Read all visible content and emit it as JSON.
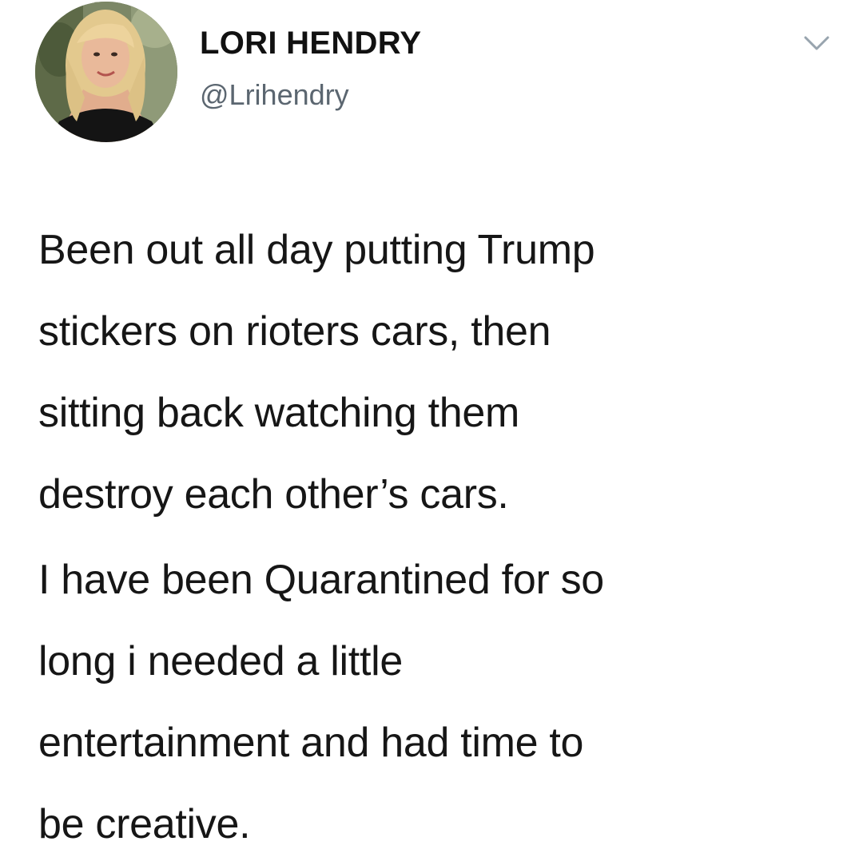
{
  "tweet": {
    "author": {
      "display_name": "LORI HENDRY",
      "handle": "@Lrihendry",
      "avatar": "profile-photo"
    },
    "menu_icon": "chevron-down-icon",
    "paragraphs": [
      "Been out all day putting Trump\nstickers on rioters cars, then\nsitting back watching them\ndestroy each other’s cars.",
      "I have been Quarantined for so\nlong i needed a little\nentertainment and had time to\nbe creative."
    ]
  }
}
